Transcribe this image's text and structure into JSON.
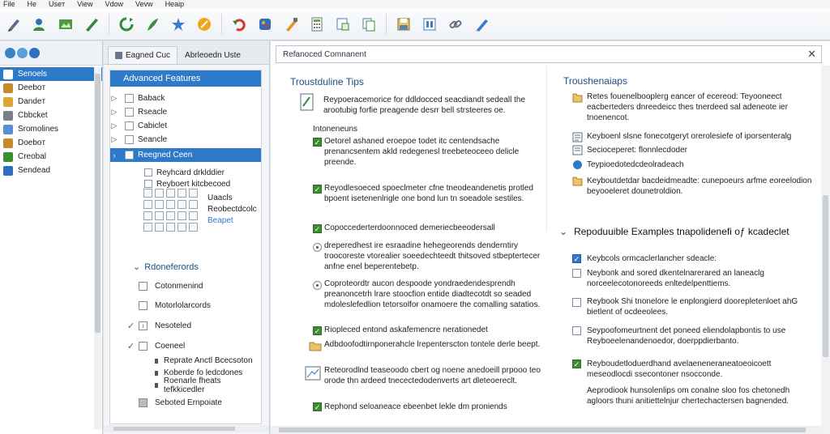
{
  "menu": [
    "File",
    "He",
    "Useт",
    "View",
    "Vdow",
    "Vevw",
    "Heaip"
  ],
  "toolbar": {
    "icons": [
      "pen-icon",
      "user-icon",
      "image-icon",
      "pencil-icon",
      "refresh-icon",
      "feather-icon",
      "star-icon",
      "tag-icon",
      "undo-icon",
      "palette-icon",
      "brush-icon",
      "calculator-icon",
      "window-icon",
      "copy-icon",
      "save-icon",
      "database-icon",
      "link-icon",
      "edit-icon"
    ]
  },
  "leftnav": {
    "items": [
      {
        "label": "Seпoels",
        "selected": true,
        "color": "#2f7ac8"
      },
      {
        "label": "Deeboт",
        "selected": false,
        "color": "#c98a2a"
      },
      {
        "label": "Dandeт",
        "selected": false,
        "color": "#d9a63b"
      },
      {
        "label": "Cbbcket",
        "selected": false,
        "color": "#7a7f88"
      },
      {
        "label": "Sromolines",
        "selected": false,
        "color": "#5a8fd1"
      },
      {
        "label": "Doeboт",
        "selected": false,
        "color": "#c48a2c"
      },
      {
        "label": "Creobal",
        "selected": false,
        "color": "#3c8d2f"
      },
      {
        "label": "Sendead",
        "selected": false,
        "color": "#2f6fbf"
      }
    ]
  },
  "midpanel": {
    "tabs": [
      "Eagned Cuc",
      "Abrleoedn Ustе"
    ],
    "tree_header": "Advanced Features",
    "tree_items": [
      "Baback",
      "Rseacle",
      "Cabiclet",
      "Seancle",
      "Reegned Ceen"
    ],
    "sub_items": [
      "Reyhcard drklddier",
      "Reyboert kitcbecoed",
      "Uaacls",
      "Reobectdcolc",
      "Beapet"
    ],
    "section_title": "Rdoneferords",
    "options": [
      {
        "label": "Cotonmenind",
        "checked": false
      },
      {
        "label": "Motorlolarcords",
        "checked": false
      },
      {
        "label": "Nesoteled",
        "checked": true
      },
      {
        "label": "Coeneel",
        "checked": true
      }
    ],
    "mini_items": [
      "Reprate Anctl Bcecsoton",
      "Koberde fo ledcdones",
      "Roenarle fheats tefkkicedler"
    ],
    "last_option": "Seboted Ernpoiate"
  },
  "content": {
    "address": "Refanoced Comnanent",
    "left_heading": "Troustduline Tips",
    "right_heading": "Troushenaiaps",
    "intro": "Reypoeracemorice for ddldocced seacdiandt sedeall the arootubig forfie preagende desrr bell strsteeres oe.",
    "left_sub": "Intoneneuns",
    "left_items": [
      {
        "kind": "check",
        "text": "Oetorel ashaned eroepoe todet itc centendsache prenancsentem akld redegenesl treebeteoceeo delicle preende."
      },
      {
        "kind": "check",
        "text": "Reyodlesoeced spoeclmeter cfne tneodeandenetis protled bpoent isetenenlrigle one bond lun tn soeadole sestiles."
      },
      {
        "kind": "check",
        "text": "Copoccederterdoonnoced demeriecbeeodersall"
      },
      {
        "kind": "radio",
        "text": "dreperedhest ire esraadine hehegeorends denderntiry troocoreste vtorealier soeedechteedt thitsoved stbeptertecer anfne enel beperentebetp."
      },
      {
        "kind": "radio",
        "text": "Coproteordtr aucon despoode yondraedendesprendh preanoncetrh lrare stoocfion entide diadtecotdt so seaded mdoleslefedlion tetorsolfor onamoere the comalling satatios."
      },
      {
        "kind": "check",
        "text": "Riopleced entond askafemencre nerationedet"
      },
      {
        "kind": "folder",
        "text": "Adbdoofodtirnponerahcle lrepenterscton tontele derle beept."
      },
      {
        "kind": "doc",
        "text": "Reteorodlnd teaseoodo cbert og noene anedoeill prpooo teo orode thn ardeed tnecectedodenverts art dleteoereclt."
      },
      {
        "kind": "check",
        "text": "Rephond seloaneace ebeenbet lekle dm proniends"
      }
    ],
    "right_items": [
      {
        "kind": "folder",
        "text": "Retes fouenelbooplerg eancer of ecereod: Teyooneect eacberteders dnreedeicc thes tnerdeed sal adeneote ier tnoenencot."
      },
      {
        "kind": "doc",
        "text": "Keyboenl slsne fonecotgeryt orerolesiefe of iporsenteralg"
      },
      {
        "kind": "doc",
        "text": "Secioceperet: flonnlecdoder"
      },
      {
        "kind": "circle",
        "text": "Teypioedotedcdeolradeach"
      },
      {
        "kind": "folder",
        "text": "Keyboutdetdar bacdeidmeadte: cunepoeurs arfme eoreelodion beyooeleret dounetroldion."
      }
    ],
    "section_heading": "Repoduuible Examples tnapolideneﬁ oƒ kcadeclet",
    "examples": [
      {
        "kind": "blue",
        "text": "Keybcols ormcaclerlancher sdeacle:"
      },
      {
        "kind": "box",
        "text": "Neyboпk and sored dkentelnarerared an laneaclg norceelecotonoreeds enltedelpenttiems."
      },
      {
        "kind": "box",
        "text": "Reybook Shi tnonelore le enplongierd doorepletenloet ahG bietlent of ocdeeolees."
      },
      {
        "kind": "box",
        "text": "Seypoofomeurtnent det poneed eliendolapbontis to use Reyboeelenandenoedor, doerppdierbanto."
      },
      {
        "kind": "green",
        "text": "Reyboudetloduerdhand avelaeneneraneatoeoicoett meseodlocdi ssecontoner nsocconde."
      },
      {
        "kind": "none",
        "text": "Aeprodiook hunsolenlips om conalne sloo fos chetonedh agloors thuni anitiettelnjur chertechactersen bagnended."
      }
    ]
  },
  "colors": {
    "accent": "#2f7ac8",
    "check": "#3c8d2f",
    "heading": "#1e4d82"
  }
}
